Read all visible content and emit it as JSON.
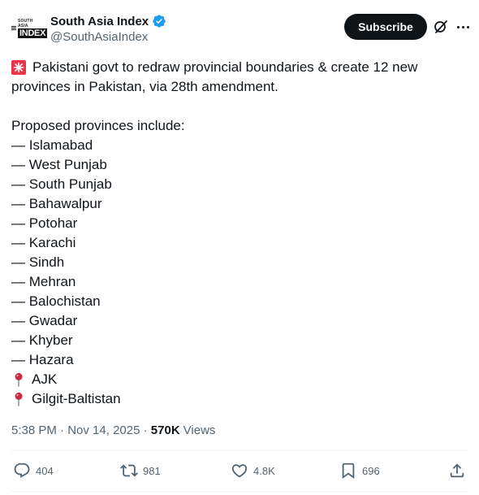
{
  "account": {
    "name": "South Asia Index",
    "handle": "@SouthAsiaIndex",
    "avatar_text_top": "SOUTH ASIA",
    "avatar_text_main": "INDEX",
    "verified_color": "#1d9bf0"
  },
  "header": {
    "subscribe_label": "Subscribe",
    "grok_icon": "grok-icon",
    "more_icon": "more-icon"
  },
  "post": {
    "lines": [
      {
        "emoji": "siren",
        "text": "Pakistani govt  to redraw provincial boundaries & create 12 new"
      },
      {
        "text": "provinces in Pakistan, via 28th amendment."
      },
      {
        "blank": true
      },
      {
        "text": "Proposed provinces include:"
      },
      {
        "text": "— Islamabad"
      },
      {
        "text": "— West Punjab"
      },
      {
        "text": "— South Punjab"
      },
      {
        "text": "— Bahawalpur"
      },
      {
        "text": "— Potohar"
      },
      {
        "text": "— Karachi"
      },
      {
        "text": "— Sindh"
      },
      {
        "text": "— Mehran"
      },
      {
        "text": "— Balochistan"
      },
      {
        "text": "— Gwadar"
      },
      {
        "text": "— Khyber"
      },
      {
        "text": "— Hazara"
      },
      {
        "emoji": "round-pushpin",
        "text": "AJK"
      },
      {
        "emoji": "round-pushpin",
        "text": "Gilgit-Baltistan"
      }
    ]
  },
  "meta": {
    "time": "5:38 PM",
    "separator": " · ",
    "date": "Nov 14, 2025",
    "views_count": "570K",
    "views_label": "Views"
  },
  "actions": {
    "replies": "404",
    "reposts": "981",
    "likes": "4.8K",
    "bookmarks": "696"
  }
}
